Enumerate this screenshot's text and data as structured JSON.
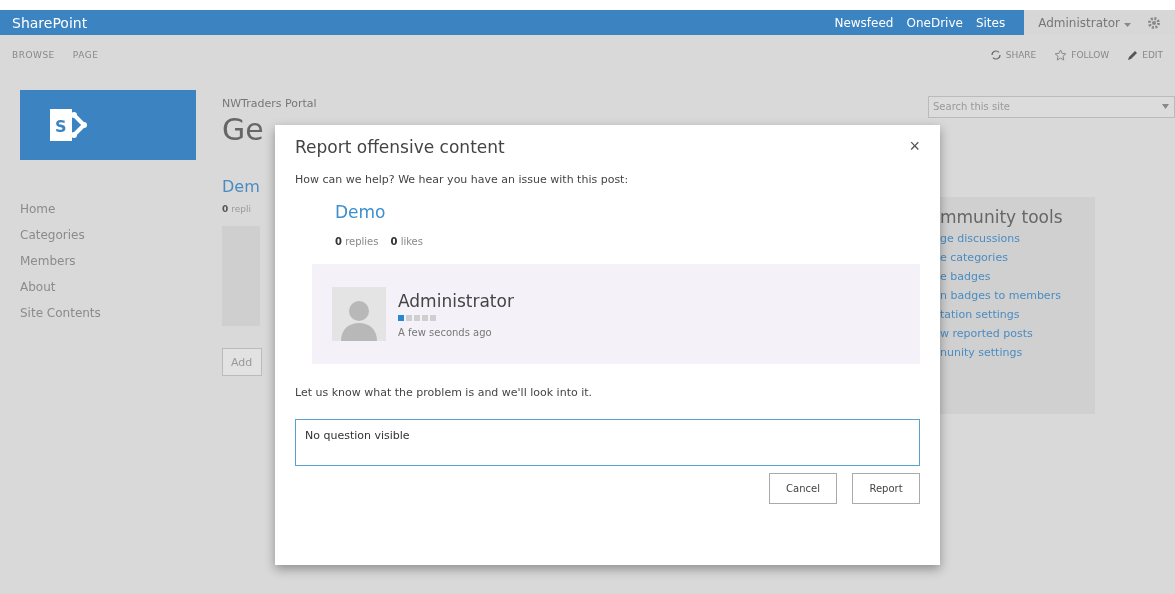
{
  "suite_bar": {
    "brand": "SharePoint",
    "links": [
      "Newsfeed",
      "OneDrive",
      "Sites"
    ],
    "user": "Administrator"
  },
  "ribbon": {
    "tabs": [
      "BROWSE",
      "PAGE"
    ],
    "actions": [
      {
        "kind": "share",
        "label": "SHARE"
      },
      {
        "kind": "follow",
        "label": "FOLLOW"
      },
      {
        "kind": "edit",
        "label": "EDIT"
      }
    ]
  },
  "logo": {
    "letter": "S"
  },
  "sidebar": {
    "items": [
      "Home",
      "Categories",
      "Members",
      "About",
      "Site Contents"
    ]
  },
  "site": {
    "breadcrumb": "NWTraders Portal",
    "title": "Ge",
    "post_title": "Dem",
    "post_stats": {
      "count": "0",
      "label": "repli"
    },
    "add_button": "Add"
  },
  "search": {
    "placeholder": "Search this site"
  },
  "community_tools": {
    "heading": "mmunity tools",
    "links": [
      "ge discussions",
      "e categories",
      "e badges",
      "n badges to members",
      "tation settings",
      "w reported posts",
      "nunity settings"
    ]
  },
  "dialog": {
    "title": "Report offensive content",
    "close": "×",
    "intro": "How can we help? We hear you have an issue with this post:",
    "post": {
      "title": "Demo",
      "stats": [
        {
          "count": "0",
          "label": "replies"
        },
        {
          "count": "0",
          "label": "likes"
        }
      ],
      "author": "Administrator",
      "level": 0.2,
      "time": "A few seconds ago"
    },
    "prompt": "Let us know what the problem is and we'll look into it.",
    "answer": "No question visible",
    "buttons": [
      "Cancel",
      "Report"
    ]
  }
}
